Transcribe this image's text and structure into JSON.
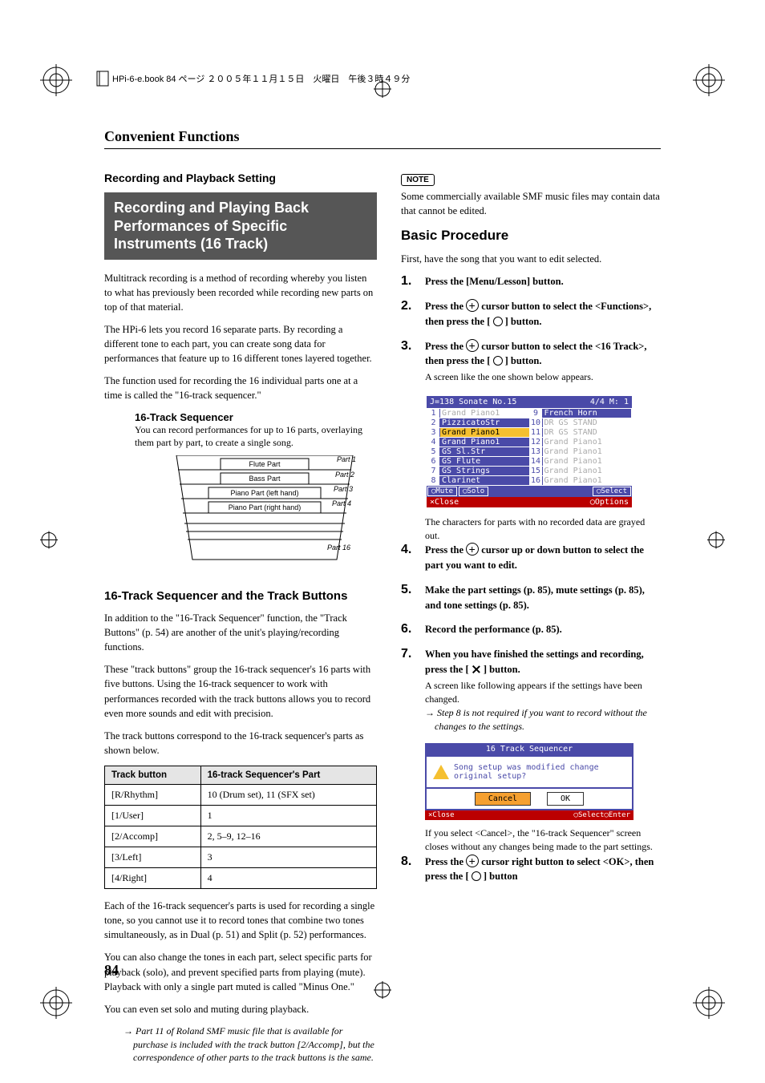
{
  "meta": {
    "header_text": "HPi-6-e.book 84 ページ ２００５年１１月１５日　火曜日　午後３時４９分"
  },
  "running_head": "Convenient Functions",
  "page_number": "84",
  "left": {
    "section_label": "Recording and Playback Setting",
    "inverse_title": "Recording and Playing Back Performances of Specific Instruments (16 Track)",
    "p1": "Multitrack recording is a method of recording whereby you listen to what has previously been recorded while recording new parts on top of that material.",
    "p2": "The HPi-6 lets you record 16 separate parts. By recording a different tone to each part, you can create song data for performances that feature up to 16 different tones layered together.",
    "p3": "The function used for recording the 16 individual parts one at a time is called the \"16-track sequencer.\"",
    "seq_head": "16-Track Sequencer",
    "seq_body": "You can record performances for up to 16 parts, overlaying them part by part, to create a single song.",
    "diagram": {
      "rows": [
        {
          "box": "Flute Part",
          "label": "Part 1"
        },
        {
          "box": "Bass Part",
          "label": "Part 2"
        },
        {
          "box": "Piano Part (left hand)",
          "label": "Part 3"
        },
        {
          "box": "Piano Part (right hand)",
          "label": "Part 4"
        }
      ],
      "last_label": "Part 16"
    },
    "h2": "16-Track Sequencer and the Track Buttons",
    "p4": "In addition to the \"16-Track Sequencer\" function, the \"Track Buttons\" (p. 54) are another of the unit's playing/recording functions.",
    "p5": "These \"track buttons\" group the 16-track sequencer's 16 parts with five buttons. Using the 16-track sequencer to work with performances recorded with the track buttons allows you to record even more sounds and edit with precision.",
    "p6": "The track buttons correspond to the 16-track sequencer's parts as shown below.",
    "table": {
      "headers": [
        "Track button",
        "16-track Sequencer's Part"
      ],
      "rows": [
        [
          "[R/Rhythm]",
          "10 (Drum set), 11 (SFX set)"
        ],
        [
          "[1/User]",
          "1"
        ],
        [
          "[2/Accomp]",
          "2, 5–9, 12–16"
        ],
        [
          "[3/Left]",
          "3"
        ],
        [
          "[4/Right]",
          "4"
        ]
      ]
    },
    "p7": "Each of the 16-track sequencer's parts is used for recording a single tone, so you cannot use it to record tones that combine two tones simultaneously, as in Dual (p. 51) and Split (p. 52) performances.",
    "p8": "You can also change the tones in each part, select specific parts for playback (solo), and prevent specified parts from playing (mute). Playback with only a single part muted is called \"Minus One.\"",
    "p9": "You can even set solo and muting during playback.",
    "note_arrow": "→  Part 11 of Roland SMF music file that is available for purchase is included with the track button [2/Accomp], but the correspondence of other parts to the track buttons is the same."
  },
  "right": {
    "note_label": "NOTE",
    "note_text": "Some commercially available SMF music files may contain data that cannot be edited.",
    "h2": "Basic Procedure",
    "intro": "First, have the song that you want to edit selected.",
    "steps": {
      "s1": {
        "num": "1.",
        "main": "Press the [Menu/Lesson] button."
      },
      "s2": {
        "num": "2.",
        "main_a": "Press the ",
        "main_b": " cursor button to select the <Functions>, then press the [ ",
        "main_c": " ] button."
      },
      "s3": {
        "num": "3.",
        "main_a": "Press the ",
        "main_b": " cursor button to select the <16 Track>, then press the [ ",
        "main_c": " ] button.",
        "sub": "A screen like the one shown below appears."
      },
      "s4": {
        "num": "4.",
        "main_a": "Press the ",
        "main_b": " cursor up or down button to select the part you want to edit."
      },
      "s5": {
        "num": "5.",
        "main": "Make the part settings (p. 85), mute settings (p. 85), and tone settings (p. 85)."
      },
      "s6": {
        "num": "6.",
        "main": "Record the performance (p. 85)."
      },
      "s7": {
        "num": "7.",
        "main_a": "When you have finished the settings and recording, press the [ ",
        "main_b": " ] button.",
        "sub": "A screen like following appears if the settings have been changed.",
        "arrow": "→  Step 8 is not required if you want to record without the changes to the settings."
      },
      "s8": {
        "num": "8.",
        "main_a": "Press the ",
        "main_b": " cursor right button to select <OK>, then press the [ ",
        "main_c": " ] button"
      }
    },
    "screen1": {
      "top_left": "J=138 Sonate No.15",
      "top_right": "4/4  M:   1",
      "cells": [
        {
          "n": "1",
          "t": "Grand Piano1",
          "g": true
        },
        {
          "n": "9",
          "t": "French Horn",
          "sel": true
        },
        {
          "n": "2",
          "t": "PizzicatoStr",
          "sel": true
        },
        {
          "n": "10",
          "t": "DR GS STAND",
          "g": true
        },
        {
          "n": "3",
          "t": "Grand Piano1",
          "hl": true
        },
        {
          "n": "11",
          "t": "DR GS STAND",
          "g": true
        },
        {
          "n": "4",
          "t": "Grand Piano1",
          "sel": true
        },
        {
          "n": "12",
          "t": "Grand Piano1",
          "g": true
        },
        {
          "n": "5",
          "t": "GS Sl.Str",
          "sel": true
        },
        {
          "n": "13",
          "t": "Grand Piano1",
          "g": true
        },
        {
          "n": "6",
          "t": "GS Flute",
          "sel": true
        },
        {
          "n": "14",
          "t": "Grand Piano1",
          "g": true
        },
        {
          "n": "7",
          "t": "GS Strings",
          "sel": true
        },
        {
          "n": "15",
          "t": "Grand Piano1",
          "g": true
        },
        {
          "n": "8",
          "t": "Clarinet",
          "sel": true
        },
        {
          "n": "16",
          "t": "Grand Piano1",
          "g": true
        }
      ],
      "btm": [
        "◯Mute",
        "◯Solo",
        "◯Select"
      ],
      "close_l": "×Close",
      "close_r": "◯Options",
      "caption": "The characters for parts with no recorded data are grayed out."
    },
    "screen2": {
      "title": "16 Track Sequencer",
      "msg": "Song setup was modified change original setup?",
      "btn1": "Cancel",
      "btn2": "OK",
      "btm_l": "×Close",
      "btm_m": "◯Select",
      "btm_r": "◯Enter",
      "caption": "If you select <Cancel>, the \"16-track Sequencer\" screen closes without any changes being made to the part settings."
    }
  }
}
